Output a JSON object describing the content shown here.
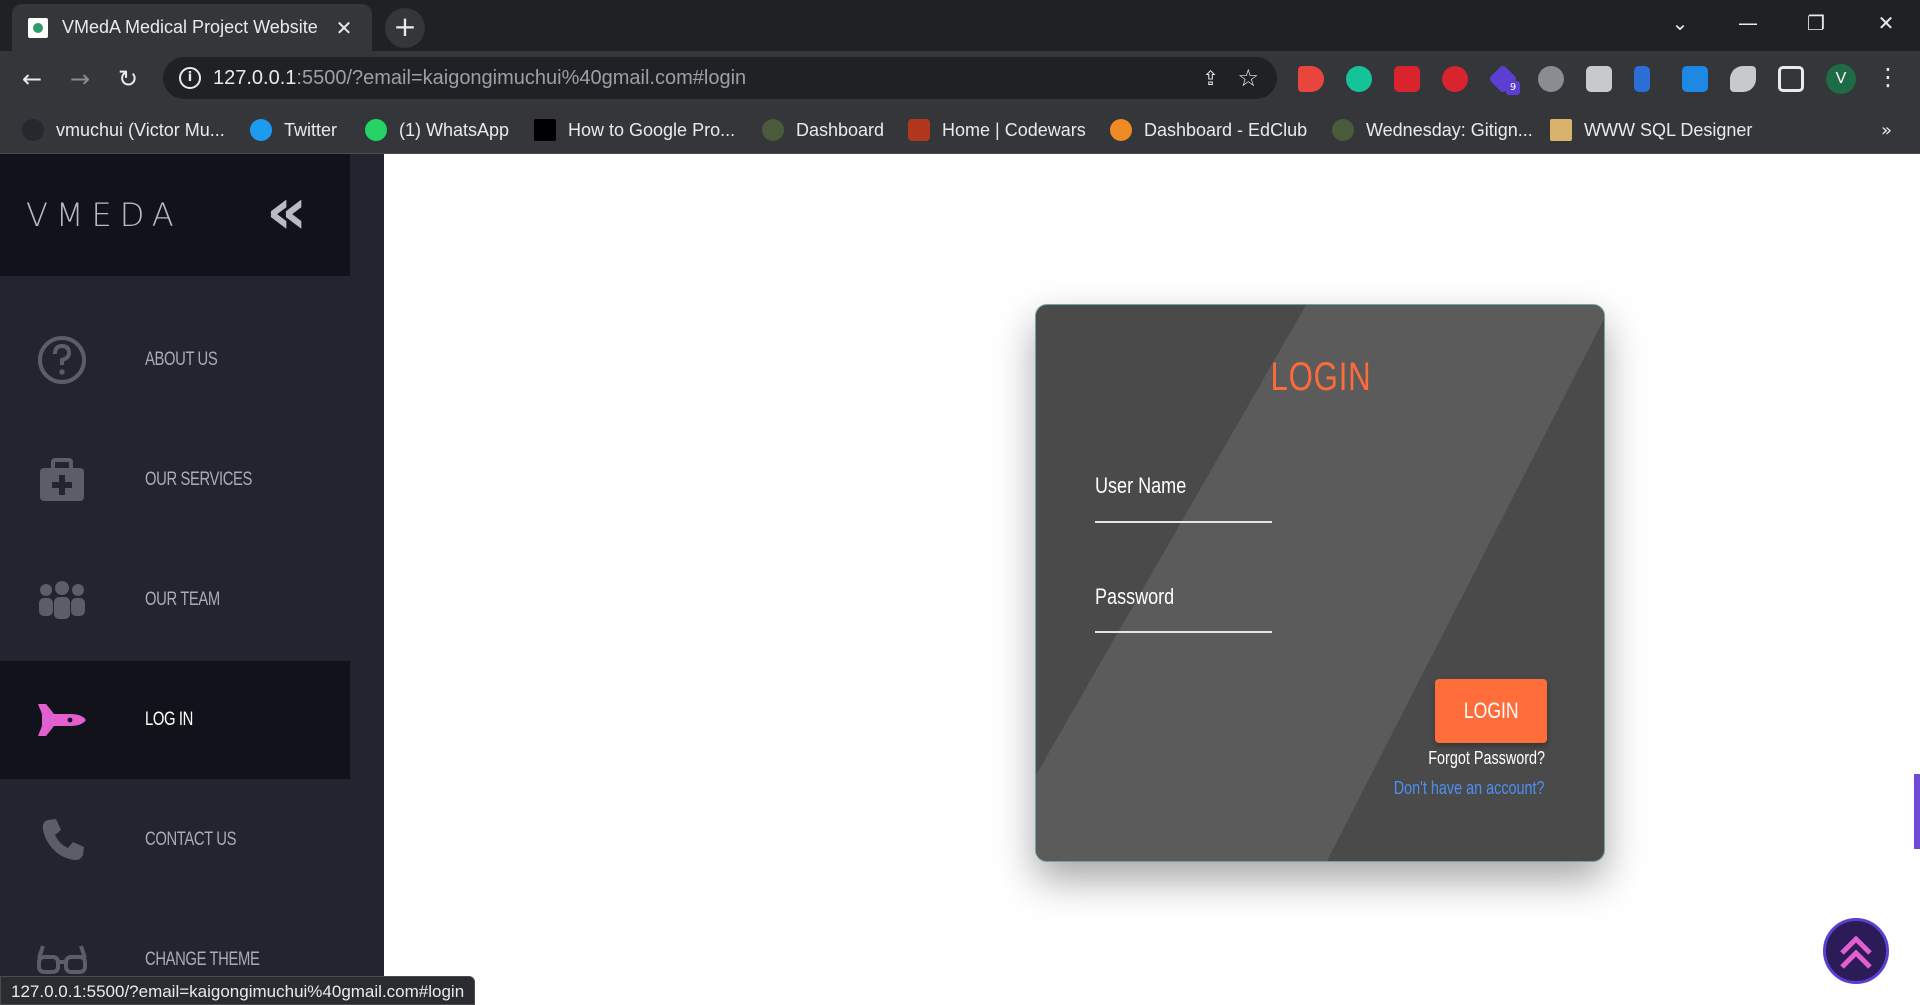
{
  "browser": {
    "tab_title": "VMedA Medical Project Website",
    "url_host": "127.0.0.1",
    "url_rest": ":5500/?email=kaigongimuchui%40gmail.com#login",
    "status_url": "127.0.0.1:5500/?email=kaigongimuchui%40gmail.com#login",
    "extension_badge": "9",
    "profile_initial": "V",
    "bookmarks": [
      {
        "label": "vmuchui (Victor Mu...",
        "icon": "github-icon",
        "color": "#24292e"
      },
      {
        "label": "Twitter",
        "icon": "twitter-icon",
        "color": "#1d9bf0"
      },
      {
        "label": "(1) WhatsApp",
        "icon": "whatsapp-icon",
        "color": "#25d366"
      },
      {
        "label": "How to Google Pro...",
        "icon": "medium-icon",
        "color": "#000000"
      },
      {
        "label": "Dashboard",
        "icon": "palm-icon",
        "color": "#4a5a3a"
      },
      {
        "label": "Home | Codewars",
        "icon": "codewars-icon",
        "color": "#b1361e"
      },
      {
        "label": "Dashboard - EdClub",
        "icon": "edclub-icon",
        "color": "#f08a24"
      },
      {
        "label": "Wednesday: Gitign...",
        "icon": "palm-icon",
        "color": "#4a5a3a"
      },
      {
        "label": "WWW SQL Designer",
        "icon": "sql-designer-icon",
        "color": "#d9b36c"
      }
    ]
  },
  "sidebar": {
    "brand": "VMEDA",
    "collapse_glyph": "«",
    "items": [
      {
        "label": "ABOUT US",
        "icon": "question-circle-icon",
        "active": false
      },
      {
        "label": "OUR SERVICES",
        "icon": "medical-kit-icon",
        "active": false
      },
      {
        "label": "OUR TEAM",
        "icon": "team-icon",
        "active": false
      },
      {
        "label": "LOG IN",
        "icon": "rocket-icon",
        "active": true
      },
      {
        "label": "CONTACT US",
        "icon": "phone-icon",
        "active": false
      },
      {
        "label": "CHANGE THEME",
        "icon": "glasses-icon",
        "active": false
      }
    ]
  },
  "login": {
    "title": "LOGIN",
    "username_label": "User Name",
    "password_label": "Password",
    "submit_label": "LOGIN",
    "forgot_label": "Forgot Password?",
    "signup_label": "Don't have an account?"
  },
  "colors": {
    "accent": "#fd6b3a",
    "sidebar_bg": "#23242f",
    "sidebar_active": "#12131a",
    "card_bg": "#4a4a4b",
    "link": "#4d8ff0"
  }
}
